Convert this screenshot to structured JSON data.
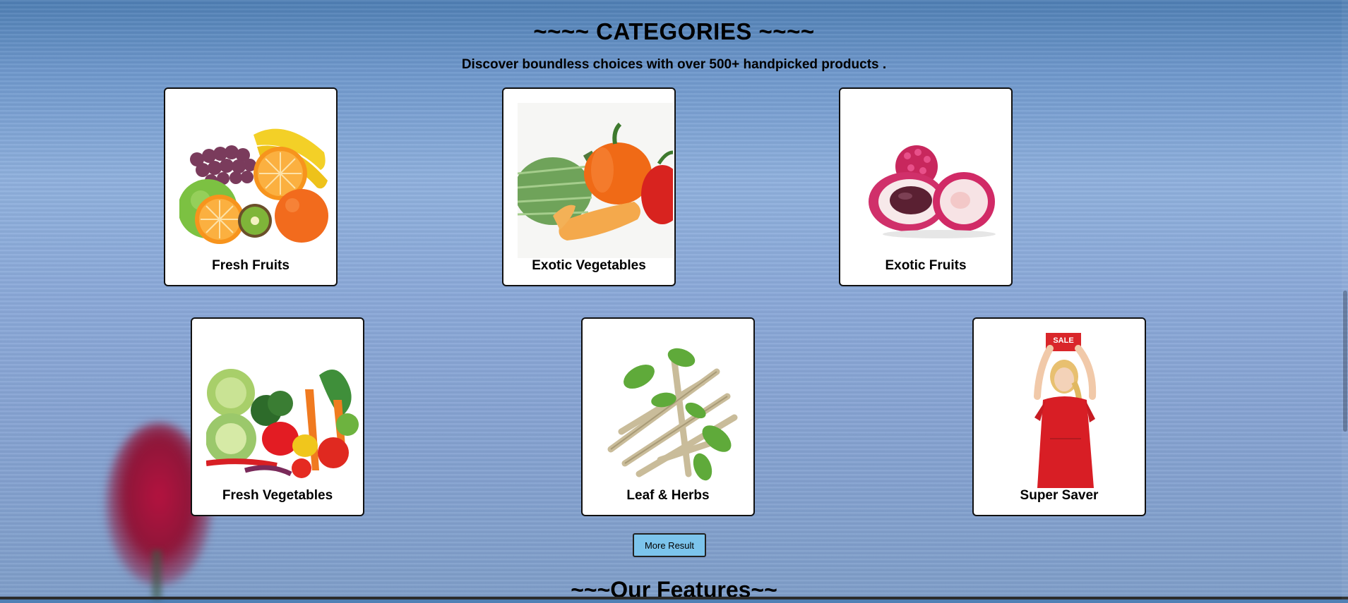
{
  "categories_section": {
    "title": "~~~~ CATEGORIES ~~~~",
    "subtitle": "Discover boundless choices with over 500+ handpicked products .",
    "items": [
      {
        "label": "Fresh Fruits",
        "icon": "fresh-fruits-image"
      },
      {
        "label": "Exotic Vegetables",
        "icon": "exotic-vegetables-image"
      },
      {
        "label": "Exotic Fruits",
        "icon": "exotic-fruits-image"
      },
      {
        "label": "Fresh Vegetables",
        "icon": "fresh-vegetables-image"
      },
      {
        "label": "Leaf & Herbs",
        "icon": "leaf-herbs-image"
      },
      {
        "label": "Super Saver",
        "icon": "super-saver-image"
      }
    ],
    "more_button_label": "More Result"
  },
  "features_section": {
    "title": "~~~Our Features~~"
  },
  "colors": {
    "button_bg": "#7cc4ec",
    "card_bg": "#ffffff",
    "card_border": "#111111"
  }
}
